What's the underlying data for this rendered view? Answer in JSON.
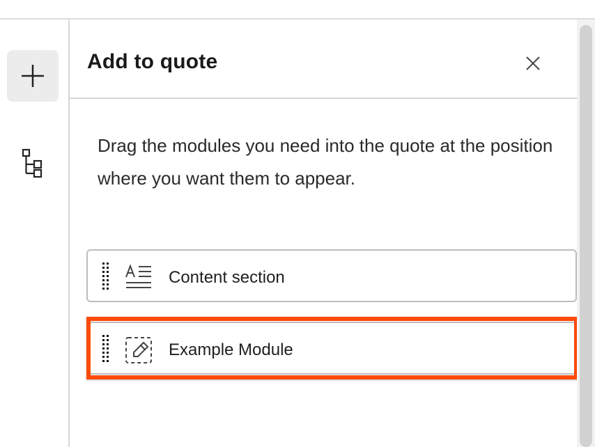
{
  "rail": {
    "add_icon": "plus-icon",
    "tree_icon": "tree-structure-icon"
  },
  "panel": {
    "title": "Add to quote",
    "close_icon": "close-icon",
    "instructions": "Drag the modules you need into the quote at the position where you want them to appear."
  },
  "modules": [
    {
      "label": "Content section",
      "icon": "text-align-icon"
    },
    {
      "label": "Example Module",
      "icon": "module-edit-icon"
    }
  ],
  "colors": {
    "highlight": "#ff4a0a",
    "rail_button_bg": "#ececec"
  }
}
